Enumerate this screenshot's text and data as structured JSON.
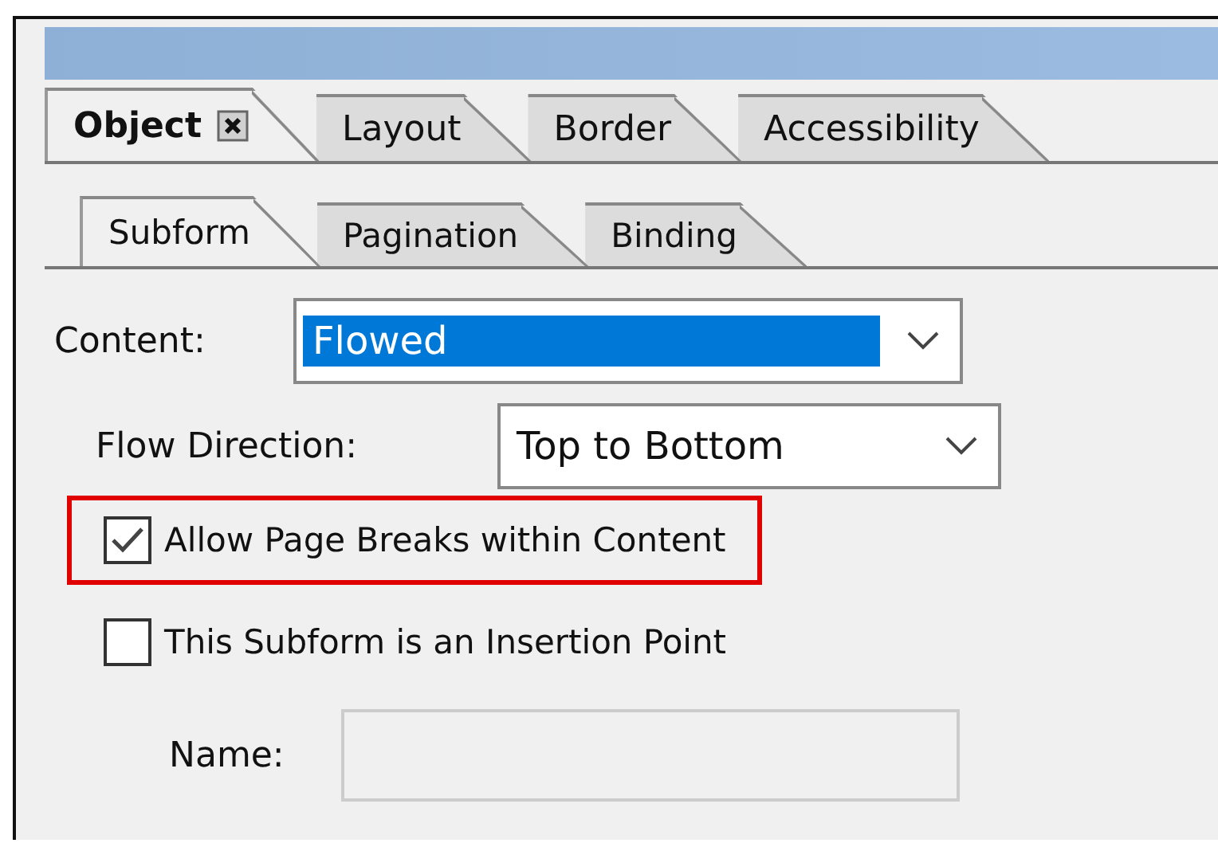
{
  "tabs": [
    {
      "label": "Object",
      "selected": true,
      "closable": true
    },
    {
      "label": "Layout",
      "selected": false,
      "closable": false
    },
    {
      "label": "Border",
      "selected": false,
      "closable": false
    },
    {
      "label": "Accessibility",
      "selected": false,
      "closable": false
    }
  ],
  "subtabs": [
    {
      "label": "Subform",
      "selected": true
    },
    {
      "label": "Pagination",
      "selected": false
    },
    {
      "label": "Binding",
      "selected": false
    }
  ],
  "content": {
    "label": "Content:",
    "value": "Flowed",
    "highlighted": true
  },
  "flow_direction": {
    "label": "Flow Direction:",
    "value": "Top to Bottom",
    "highlighted": false
  },
  "checkboxes": [
    {
      "label": "Allow Page Breaks within Content",
      "checked": true,
      "annotated": true
    },
    {
      "label": "This Subform is an Insertion Point",
      "checked": false,
      "annotated": false
    }
  ],
  "name": {
    "label": "Name:",
    "disabled": true
  }
}
